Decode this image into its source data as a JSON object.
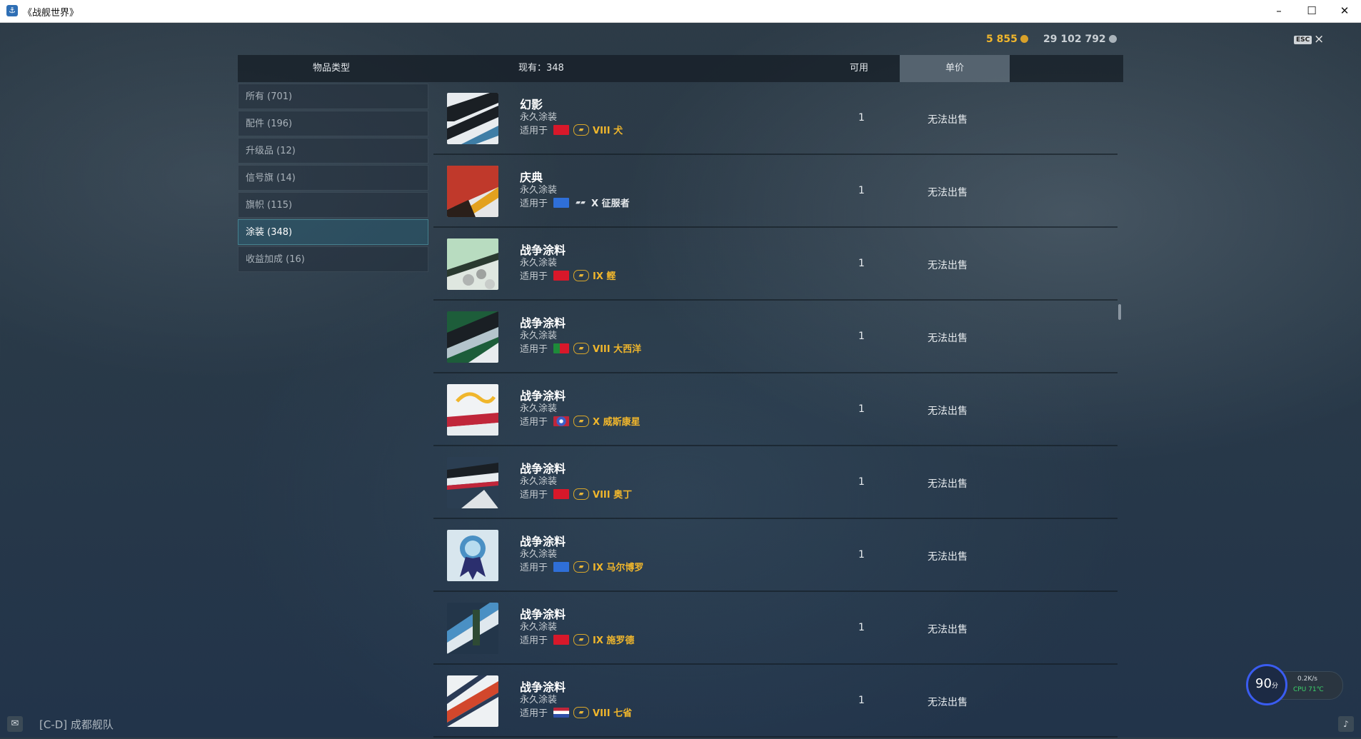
{
  "window": {
    "title": "《战舰世界》",
    "minimize": "–",
    "maximize": "☐",
    "close": "✕"
  },
  "currency": {
    "gold": "5 855",
    "credits": "29 102 792",
    "gold_color": "#f0b62c",
    "credits_color": "#c9cfd4"
  },
  "esc": {
    "label": "ESC",
    "close": "×"
  },
  "header": {
    "category_title": "物品类型",
    "owned": "现有：348",
    "available": "可用",
    "unit_price": "单价"
  },
  "sidebar": {
    "items": [
      {
        "label": "所有 (701)",
        "active": false
      },
      {
        "label": "配件 (196)",
        "active": false
      },
      {
        "label": "升级品 (12)",
        "active": false
      },
      {
        "label": "信号旗 (14)",
        "active": false
      },
      {
        "label": "旗帜 (115)",
        "active": false
      },
      {
        "label": "涂装 (348)",
        "active": true
      },
      {
        "label": "收益加成 (16)",
        "active": false
      }
    ]
  },
  "rows": [
    {
      "name": "幻影",
      "sub": "永久涂装",
      "applies": "适用于",
      "ship": "VIII 犬",
      "qty": "1",
      "price": "无法出售",
      "flag": "red-cross",
      "premium": true
    },
    {
      "name": "庆典",
      "sub": "永久涂装",
      "applies": "适用于",
      "ship": "X 征服者",
      "qty": "1",
      "price": "无法出售",
      "flag": "blue",
      "premium": false
    },
    {
      "name": "战争涂料",
      "sub": "永久涂装",
      "applies": "适用于",
      "ship": "IX 鲣",
      "qty": "1",
      "price": "无法出售",
      "flag": "red-cross",
      "premium": true
    },
    {
      "name": "战争涂料",
      "sub": "永久涂装",
      "applies": "适用于",
      "ship": "VIII 大西洋",
      "qty": "1",
      "price": "无法出售",
      "flag": "portugal",
      "premium": true
    },
    {
      "name": "战争涂料",
      "sub": "永久涂装",
      "applies": "适用于",
      "ship": "X 威斯康星",
      "qty": "1",
      "price": "无法出售",
      "flag": "usa",
      "premium": true
    },
    {
      "name": "战争涂料",
      "sub": "永久涂装",
      "applies": "适用于",
      "ship": "VIII 奥丁",
      "qty": "1",
      "price": "无法出售",
      "flag": "red-cross",
      "premium": true
    },
    {
      "name": "战争涂料",
      "sub": "永久涂装",
      "applies": "适用于",
      "ship": "IX 马尔博罗",
      "qty": "1",
      "price": "无法出售",
      "flag": "blue",
      "premium": true
    },
    {
      "name": "战争涂料",
      "sub": "永久涂装",
      "applies": "适用于",
      "ship": "IX 施罗德",
      "qty": "1",
      "price": "无法出售",
      "flag": "red-cross",
      "premium": true
    },
    {
      "name": "战争涂料",
      "sub": "永久涂装",
      "applies": "适用于",
      "ship": "VIII 七省",
      "qty": "1",
      "price": "无法出售",
      "flag": "blue-red",
      "premium": true
    }
  ],
  "footer": {
    "chat_icon": "chat-icon",
    "clan": "[C-D]  成都舰队",
    "bell_icon": "bell-icon"
  },
  "perf": {
    "score": "90",
    "score_unit": "分",
    "net": "0.2K/s",
    "cpu": "CPU 71℃"
  }
}
